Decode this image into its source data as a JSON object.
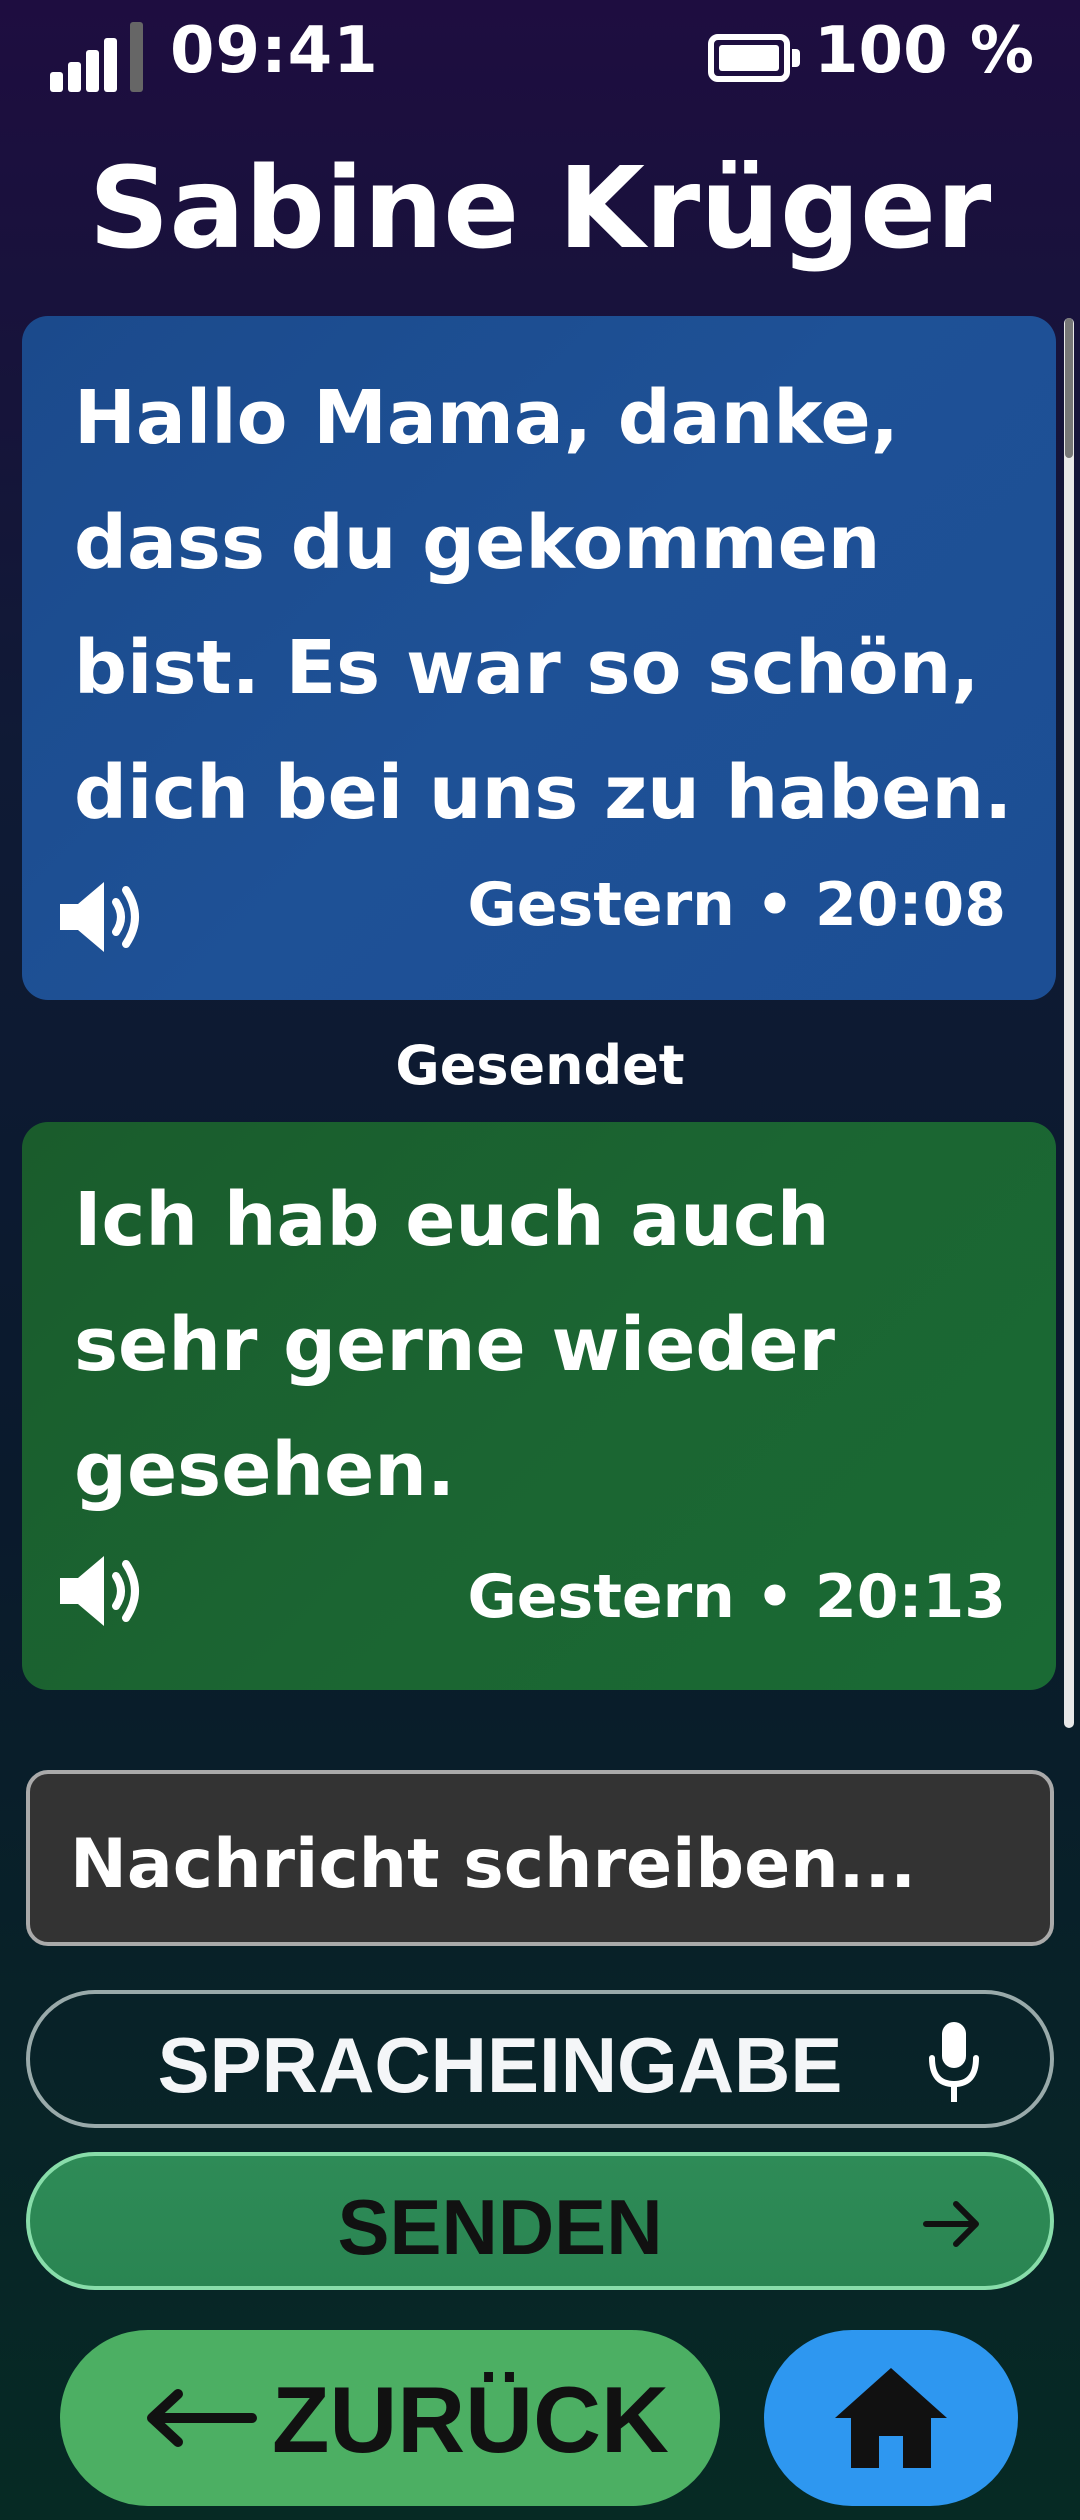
{
  "status_bar": {
    "time": "09:41",
    "battery_percent": "100 %",
    "signal_icon": "signal-bars-icon",
    "battery_icon": "battery-full-icon"
  },
  "conversation": {
    "contact_name": "Sabine Krüger",
    "messages": [
      {
        "direction": "received",
        "text": "Hallo Mama, danke, dass du gekommen bist. Es war so schön, dich bei uns zu haben.",
        "time": "Gestern • 20:08",
        "icon": "speaker-icon"
      },
      {
        "direction": "sent",
        "status": "Gesendet",
        "text": "Ich hab euch auch sehr gerne wieder gesehen.",
        "time": "Gestern • 20:13",
        "icon": "speaker-icon"
      }
    ]
  },
  "composer": {
    "placeholder": "Nachricht schreiben...",
    "value": "",
    "voice_label": "SPRACHEINGABE",
    "send_label": "SENDEN"
  },
  "navigation": {
    "back_label": "ZURÜCK",
    "home_icon": "home-icon"
  },
  "colors": {
    "received_bubble": "#1e5196",
    "sent_bubble": "#1b6532",
    "send_button": "#2e8b57",
    "back_button": "#4caf63",
    "home_button": "#2e97f0"
  }
}
